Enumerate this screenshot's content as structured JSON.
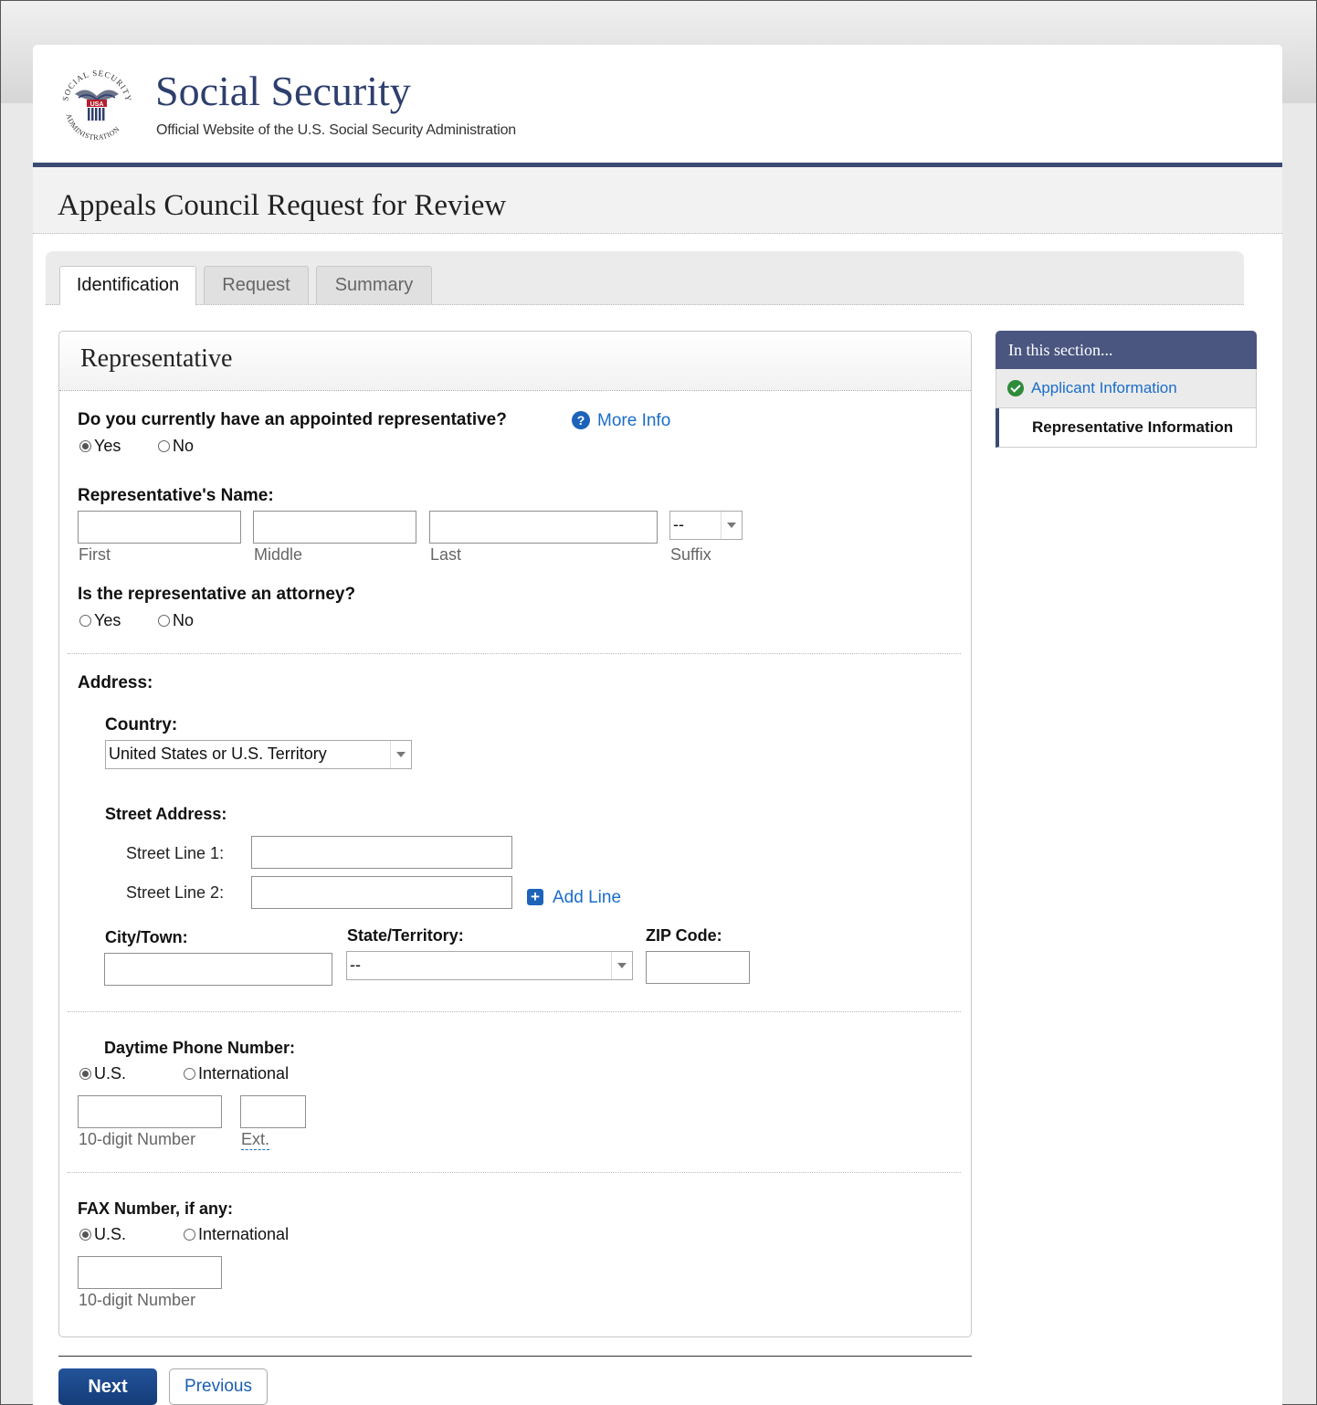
{
  "header": {
    "site_title": "Social Security",
    "site_subtitle": "Official Website of the U.S. Social Security Administration",
    "logo_ring_text": "SOCIAL SECURITY ADMINISTRATION",
    "logo_usa": "USA"
  },
  "page_title": "Appeals Council Request for Review",
  "tabs": [
    {
      "label": "Identification",
      "active": true
    },
    {
      "label": "Request",
      "active": false
    },
    {
      "label": "Summary",
      "active": false
    }
  ],
  "panel": {
    "title": "Representative",
    "q_appointed": "Do you currently have an appointed representative?",
    "more_info": "More Info",
    "appointed_options": [
      {
        "label": "Yes",
        "checked": true
      },
      {
        "label": "No",
        "checked": false
      }
    ],
    "rep_name_label": "Representative's Name:",
    "name_sub": {
      "first": "First",
      "middle": "Middle",
      "last": "Last",
      "suffix": "Suffix"
    },
    "suffix_value": "--",
    "q_attorney": "Is the representative an attorney?",
    "attorney_options": [
      {
        "label": "Yes",
        "checked": false
      },
      {
        "label": "No",
        "checked": false
      }
    ],
    "address_label": "Address:",
    "country_label": "Country:",
    "country_value": "United States or U.S. Territory",
    "street_label": "Street Address:",
    "street_line1": "Street Line 1:",
    "street_line2": "Street Line 2:",
    "add_line": "Add Line",
    "city_label": "City/Town:",
    "state_label": "State/Territory:",
    "state_value": "--",
    "zip_label": "ZIP Code:",
    "phone_label": "Daytime Phone Number:",
    "phone_options": [
      {
        "label": "U.S.",
        "checked": true
      },
      {
        "label": "International",
        "checked": false
      }
    ],
    "phone_number_sub": "10-digit Number",
    "phone_ext_sub": "Ext.",
    "fax_label": "FAX Number, if any:",
    "fax_options": [
      {
        "label": "U.S.",
        "checked": true
      },
      {
        "label": "International",
        "checked": false
      }
    ],
    "fax_number_sub": "10-digit Number"
  },
  "sidebar": {
    "heading": "In this section...",
    "items": [
      {
        "label": "Applicant Information",
        "status": "complete"
      },
      {
        "label": "Representative Information",
        "status": "current"
      }
    ]
  },
  "buttons": {
    "next": "Next",
    "previous": "Previous"
  },
  "colors": {
    "brand_navy": "#2e3f6e",
    "sidebar_head": "#4a5680",
    "link": "#1a6dc9",
    "next_button": "#1b4585",
    "check_green": "#2e8b3a"
  }
}
